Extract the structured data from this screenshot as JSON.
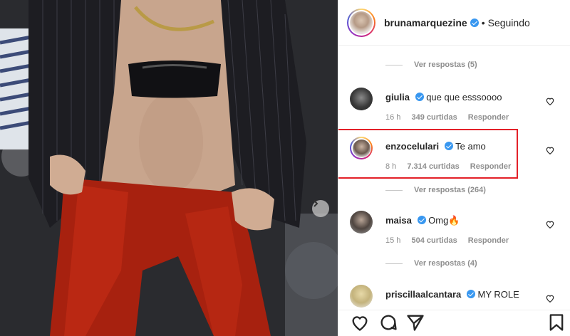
{
  "post": {
    "username": "brunamarquezine",
    "separator": "•",
    "follow_status": "Seguindo"
  },
  "comments_list": {
    "view_replies_top": "Ver respostas (5)",
    "items": [
      {
        "username": "giulia",
        "text": "que que esssoooo",
        "time": "16 h",
        "likes": "349 curtidas",
        "reply": "Responder"
      },
      {
        "username": "enzocelulari",
        "text": "Te amo",
        "time": "8 h",
        "likes": "7.314 curtidas",
        "reply": "Responder",
        "view_replies": "Ver respostas (264)"
      },
      {
        "username": "maisa",
        "text": "Omg🔥",
        "time": "15 h",
        "likes": "504 curtidas",
        "reply": "Responder",
        "view_replies": "Ver respostas (4)"
      },
      {
        "username": "priscillaalcantara",
        "text": "MY ROLE"
      }
    ]
  },
  "colors": {
    "verified": "#3897f0",
    "highlight_box": "#e32129",
    "muted_text": "#8e8e8e"
  },
  "icons": [
    "heart-icon",
    "comment-icon",
    "share-icon",
    "bookmark-icon",
    "next-arrow-icon",
    "verified-badge-icon"
  ]
}
